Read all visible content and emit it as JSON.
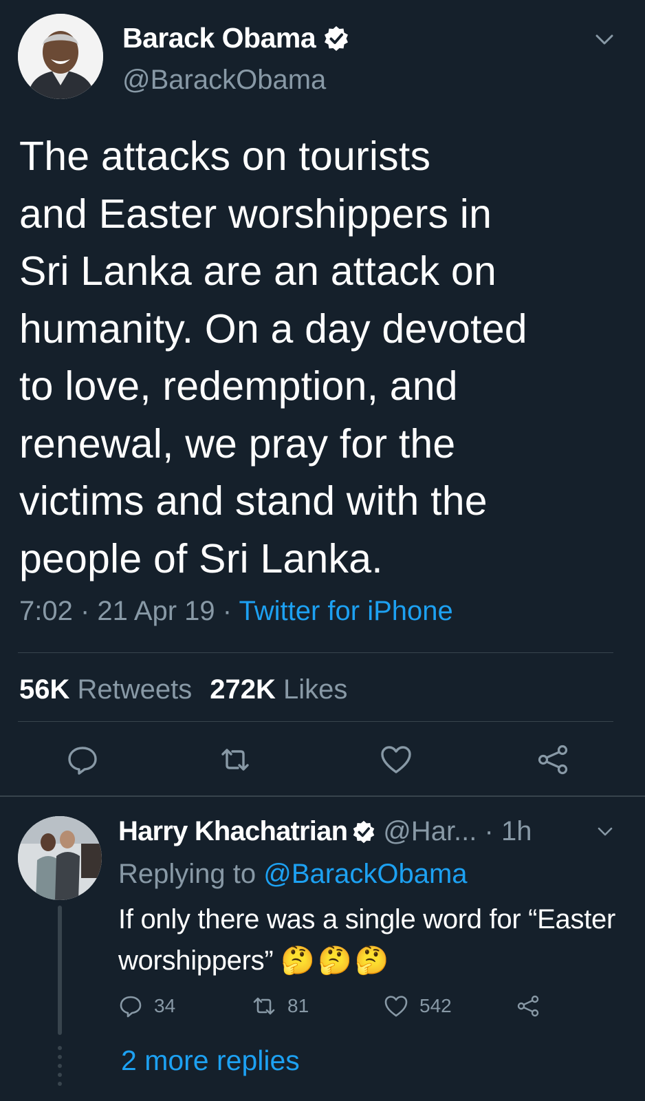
{
  "tweet": {
    "author_name": "Barack Obama",
    "author_handle": "@BarackObama",
    "text": "The attacks on tourists\nand Easter worshippers in\nSri Lanka are an attack on\nhumanity. On a day devoted\nto love, redemption, and\nrenewal, we pray for the\nvictims and stand with the\npeople of Sri Lanka.",
    "time": "7:02",
    "date": "21 Apr 19",
    "source": "Twitter for iPhone",
    "retweets_count": "56K",
    "retweets_label": "Retweets",
    "likes_count": "272K",
    "likes_label": "Likes"
  },
  "reply": {
    "author_name": "Harry Khachatrian",
    "author_handle": "@Har...",
    "time": "1h",
    "replying_prefix": "Replying to",
    "replying_to": "@BarackObama",
    "text": "If only there was a single word for “Easter worshippers”",
    "emojis": "🤔🤔🤔",
    "reply_count": "34",
    "retweet_count": "81",
    "like_count": "542",
    "more_replies": "2 more replies"
  },
  "colors": {
    "background": "#15202b",
    "accent": "#1da1f2",
    "secondary_text": "#8899a6",
    "divider": "#38444d"
  },
  "icons": {
    "verified": "verified-badge-icon",
    "chevron": "chevron-down-icon",
    "reply": "reply-icon",
    "retweet": "retweet-icon",
    "like": "heart-icon",
    "share": "share-icon"
  }
}
